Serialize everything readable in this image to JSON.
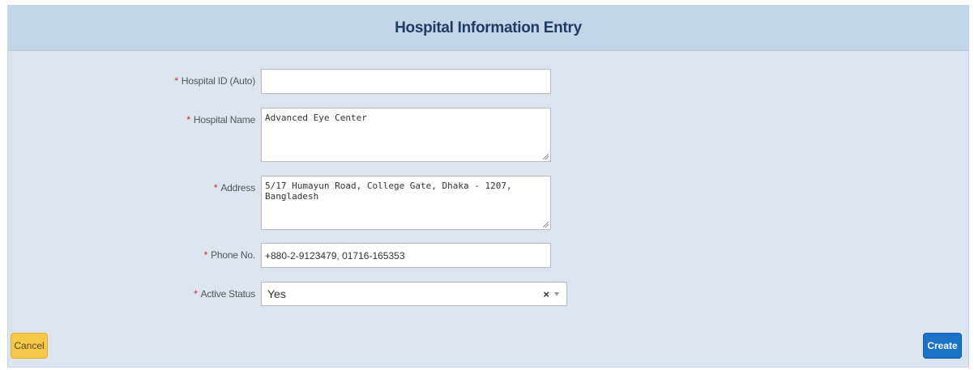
{
  "header": {
    "title": "Hospital Information Entry"
  },
  "form": {
    "required_marker": "*",
    "hospital_id": {
      "label": "Hospital ID (Auto)",
      "value": ""
    },
    "hospital_name": {
      "label": "Hospital Name",
      "value": "Advanced Eye Center"
    },
    "address": {
      "label": "Address",
      "value": "5/17 Humayun Road, College Gate, Dhaka - 1207, Bangladesh"
    },
    "phone": {
      "label": "Phone No.",
      "value": "+880-2-9123479, 01716-165353"
    },
    "active_status": {
      "label": "Active Status",
      "value": "Yes",
      "clear_glyph": "×"
    }
  },
  "buttons": {
    "cancel_label": "Cancel",
    "create_label": "Create"
  },
  "colors": {
    "header_bg": "#c3d5e8",
    "panel_bg": "#dce5ef",
    "cancel": "#f5c84a",
    "create": "#1a73c9",
    "required": "#d0282b"
  }
}
